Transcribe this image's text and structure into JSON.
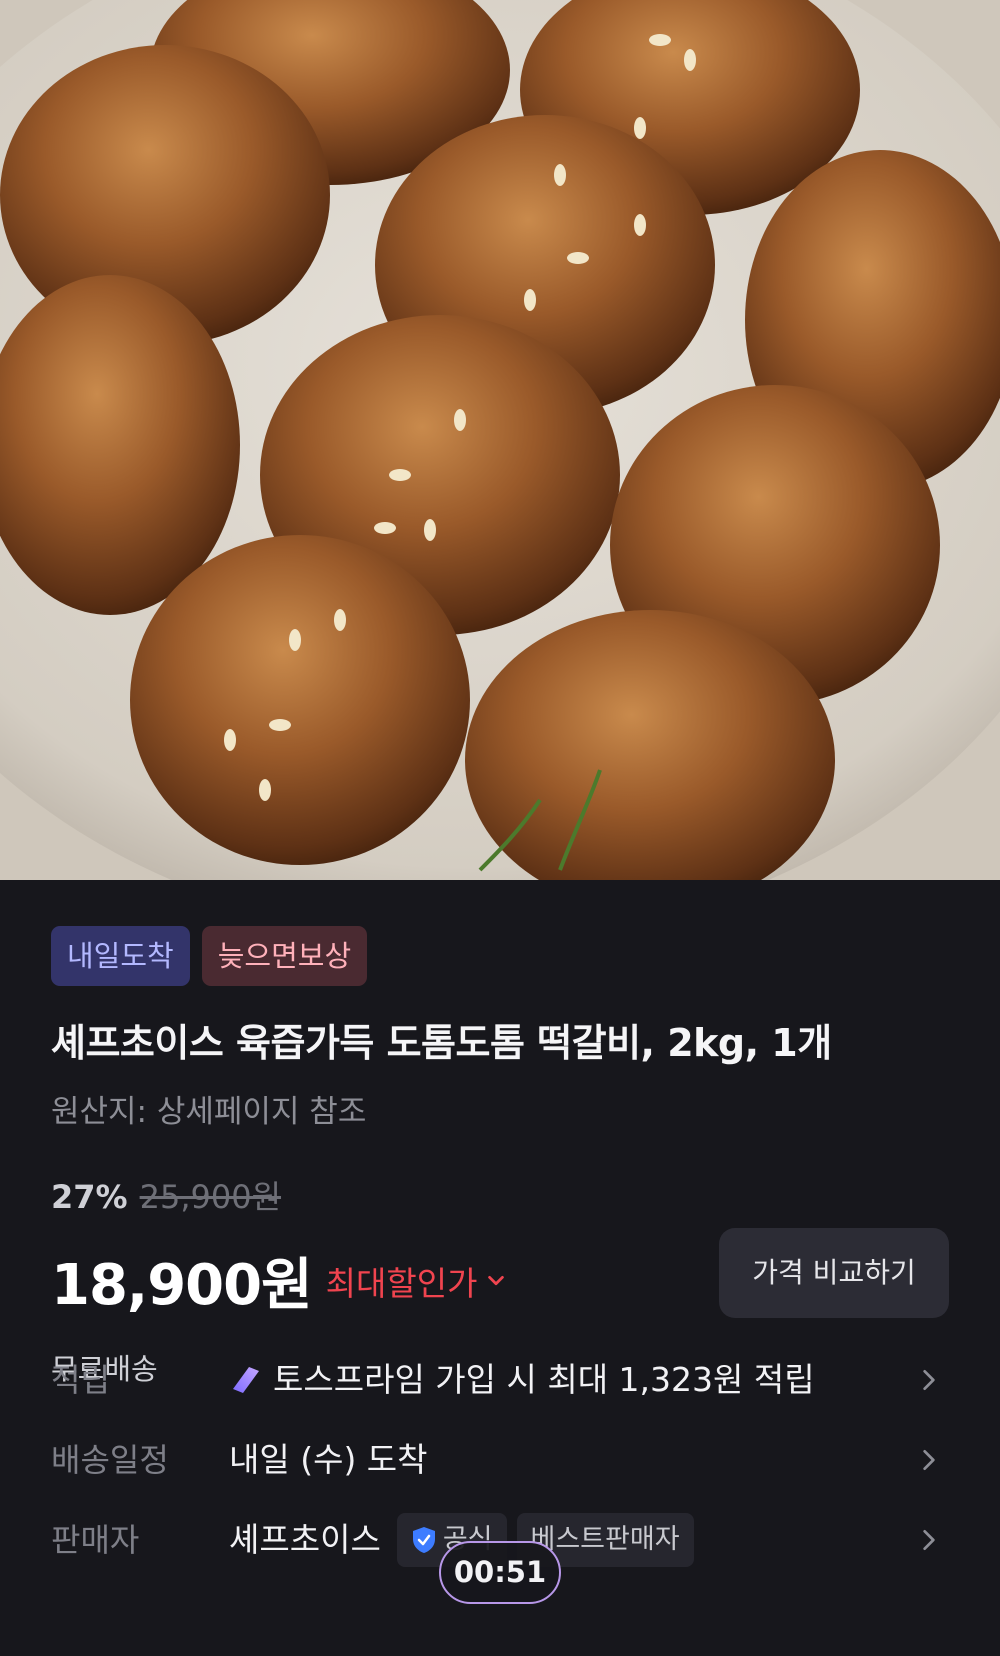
{
  "product": {
    "badges": [
      "내일도착",
      "늦으면보상"
    ],
    "title": "셰프초이스 육즙가득 도톰도톰 떡갈비, 2kg, 1개",
    "origin": "원산지: 상세페이지 참조",
    "discount_percent": "27%",
    "original_price": "25,900원",
    "sale_price": "18,900원",
    "max_discount_label": "최대할인가",
    "compare_button": "가격 비교하기",
    "shipping": "무료배송"
  },
  "details": {
    "points": {
      "label": "적립",
      "value": "토스프라임 가입 시 최대 1,323원 적립"
    },
    "delivery": {
      "label": "배송일정",
      "value": "내일 (수) 도착"
    },
    "seller": {
      "label": "판매자",
      "value": "셰프초이스",
      "tags": [
        "공식",
        "베스트판매자"
      ]
    }
  },
  "overlay": {
    "timer": "00:51"
  },
  "colors": {
    "accent_red": "#f0444f",
    "badge_blue_text": "#b3b8ff",
    "badge_red_text": "#ffb1ba",
    "timer_border": "#b797e8"
  }
}
